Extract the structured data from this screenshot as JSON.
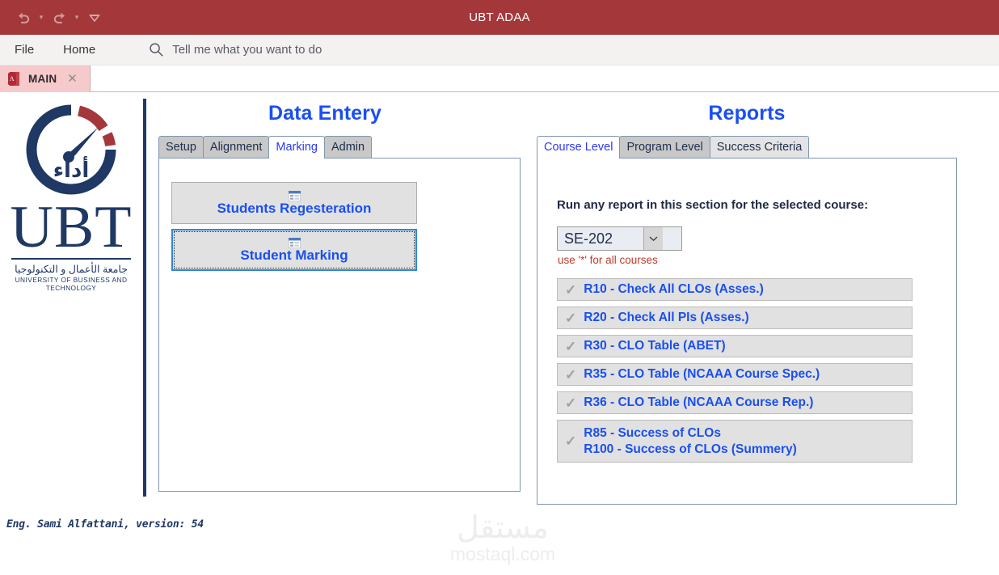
{
  "window": {
    "title": "UBT ADAA",
    "accent_red": "#a4373a",
    "quick_access": [
      {
        "name": "undo",
        "glyph": "↰"
      },
      {
        "name": "redo",
        "glyph": "↱"
      },
      {
        "name": "customize-quick-access-toolbar",
        "glyph": "▽"
      }
    ]
  },
  "menubar": {
    "items": [
      {
        "label": "File"
      },
      {
        "label": "Home"
      }
    ],
    "search_placeholder": "Tell me what you want to do"
  },
  "doc_tabs": [
    {
      "label": "MAIN",
      "close": "✕",
      "active": true
    }
  ],
  "logo": {
    "wordmark": "UBT",
    "arabic_center": "أداء",
    "arabic_name": "جامعة الأعمال و التكنولوجيا",
    "english_name": "UNIVERSITY OF BUSINESS AND TECHNOLOGY",
    "navy": "#1f3864",
    "red": "#a4373a"
  },
  "data_entry": {
    "heading": "Data Entery",
    "tabs": [
      {
        "label": "Setup",
        "state": "normal"
      },
      {
        "label": "Alignment",
        "state": "normal"
      },
      {
        "label": "Marking",
        "state": "active"
      },
      {
        "label": "Admin",
        "state": "normal"
      }
    ],
    "buttons": [
      {
        "label": "Students Regesteration",
        "icon": "form-icon",
        "focused": false
      },
      {
        "label": "Student Marking",
        "icon": "form-icon",
        "focused": true
      }
    ]
  },
  "reports": {
    "heading": "Reports",
    "tabs": [
      {
        "label": "Course Level",
        "state": "active"
      },
      {
        "label": "Program Level",
        "state": "hover"
      },
      {
        "label": "Success Criteria",
        "state": "normal"
      }
    ],
    "instruction": "Run any report in this section for the selected course:",
    "course_combo": {
      "value": "SE-202",
      "arrow": "⌄"
    },
    "hint": "use '*' for all courses",
    "items": [
      {
        "check": "✓",
        "lines": [
          "R10 - Check All CLOs (Asses.)"
        ]
      },
      {
        "check": "✓",
        "lines": [
          "R20 - Check All PIs (Asses.)"
        ]
      },
      {
        "check": "✓",
        "lines": [
          "R30 - CLO Table (ABET)"
        ]
      },
      {
        "check": "✓",
        "lines": [
          "R35 - CLO Table (NCAAA Course Spec.)"
        ]
      },
      {
        "check": "✓",
        "lines": [
          "R36 - CLO Table (NCAAA Course Rep.)"
        ]
      },
      {
        "check": "✓",
        "lines": [
          "R85 - Success of CLOs",
          "R100 - Success of CLOs (Summery)"
        ]
      }
    ]
  },
  "footer": {
    "credit": "Eng. Sami Alfattani, version: 54"
  },
  "watermark": {
    "arabic": "مستقل",
    "latin": "mostaql.com"
  }
}
